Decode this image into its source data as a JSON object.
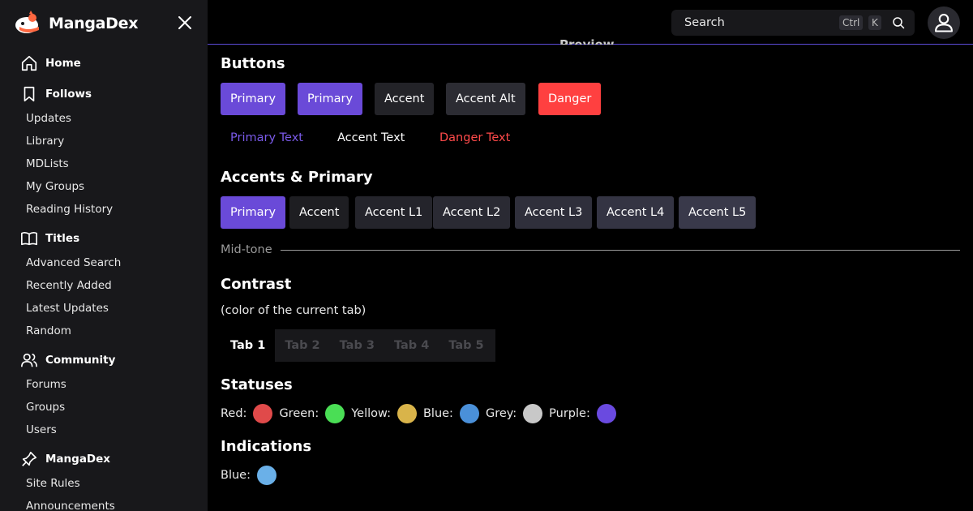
{
  "brand": {
    "name": "MangaDex"
  },
  "nav": {
    "home": "Home",
    "follows": {
      "label": "Follows",
      "items": [
        "Updates",
        "Library",
        "MDLists",
        "My Groups",
        "Reading History"
      ]
    },
    "titles": {
      "label": "Titles",
      "items": [
        "Advanced Search",
        "Recently Added",
        "Latest Updates",
        "Random"
      ]
    },
    "community": {
      "label": "Community",
      "items": [
        "Forums",
        "Groups",
        "Users"
      ]
    },
    "mangadex": {
      "label": "MangaDex",
      "items": [
        "Site Rules",
        "Announcements"
      ]
    }
  },
  "header": {
    "search_placeholder": "Search",
    "kbd_ctrl": "Ctrl",
    "kbd_k": "K",
    "preview": "Preview"
  },
  "sections": {
    "buttons": {
      "title": "Buttons",
      "items": [
        "Primary",
        "Primary",
        "Accent",
        "Accent Alt",
        "Danger"
      ],
      "text_items": [
        "Primary Text",
        "Accent Text",
        "Danger Text"
      ]
    },
    "accents": {
      "title": "Accents & Primary",
      "items": [
        "Primary",
        "Accent",
        "Accent L1",
        "Accent L2",
        "Accent L3",
        "Accent L4",
        "Accent L5"
      ]
    },
    "midtone": "Mid-tone",
    "contrast": {
      "title": "Contrast",
      "subtitle": "(color of the current tab)",
      "tabs": [
        "Tab 1",
        "Tab 2",
        "Tab 3",
        "Tab 4",
        "Tab 5"
      ]
    },
    "statuses": {
      "title": "Statuses",
      "items": [
        {
          "label": "Red:",
          "color": "#e04a4a"
        },
        {
          "label": "Green:",
          "color": "#4ade55"
        },
        {
          "label": "Yellow:",
          "color": "#d9b44a"
        },
        {
          "label": "Blue:",
          "color": "#4a90d9"
        },
        {
          "label": "Grey:",
          "color": "#c8c8c8"
        },
        {
          "label": "Purple:",
          "color": "#6a4ae0"
        }
      ]
    },
    "indications": {
      "title": "Indications",
      "items": [
        {
          "label": "Blue:",
          "color": "#6ab0e8"
        }
      ]
    }
  },
  "colors": {
    "primary": "#6a4ad8",
    "accent": "#232328",
    "accent_alt": "#2c2c33",
    "danger": "#ff4040",
    "sidebar_bg": "#18181b"
  }
}
